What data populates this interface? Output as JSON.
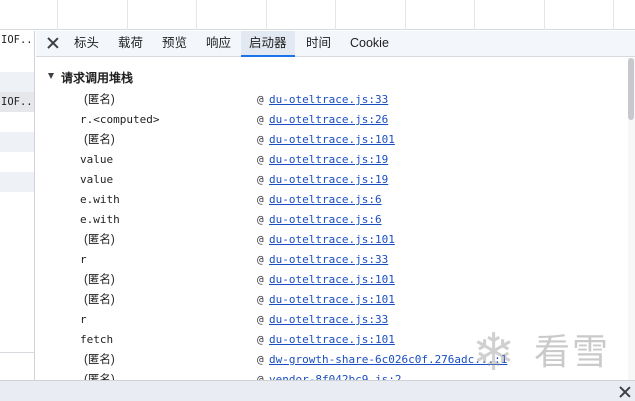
{
  "left_list": {
    "rows": [
      {
        "text": "IOF...",
        "style": "plain"
      },
      {
        "text": "",
        "style": "plain"
      },
      {
        "text": "",
        "style": "shade"
      },
      {
        "text": "IOF...",
        "style": "sel"
      },
      {
        "text": "",
        "style": "plain"
      },
      {
        "text": "",
        "style": "shade"
      },
      {
        "text": "",
        "style": "plain"
      },
      {
        "text": "",
        "style": "shade"
      }
    ]
  },
  "tabs": [
    {
      "label": "标头",
      "active": false
    },
    {
      "label": "载荷",
      "active": false
    },
    {
      "label": "预览",
      "active": false
    },
    {
      "label": "响应",
      "active": false
    },
    {
      "label": "启动器",
      "active": true
    },
    {
      "label": "时间",
      "active": false
    },
    {
      "label": "Cookie",
      "active": false
    }
  ],
  "section": {
    "title": "请求调用堆栈"
  },
  "at_symbol": "@",
  "frames": [
    {
      "fn": "(匿名)",
      "anon": true,
      "src": "du-oteltrace.js:33"
    },
    {
      "fn": "r.<computed>",
      "anon": false,
      "src": "du-oteltrace.js:26"
    },
    {
      "fn": "(匿名)",
      "anon": true,
      "src": "du-oteltrace.js:101"
    },
    {
      "fn": "value",
      "anon": false,
      "src": "du-oteltrace.js:19"
    },
    {
      "fn": "value",
      "anon": false,
      "src": "du-oteltrace.js:19"
    },
    {
      "fn": "e.with",
      "anon": false,
      "src": "du-oteltrace.js:6"
    },
    {
      "fn": "e.with",
      "anon": false,
      "src": "du-oteltrace.js:6"
    },
    {
      "fn": "(匿名)",
      "anon": true,
      "src": "du-oteltrace.js:101"
    },
    {
      "fn": "r",
      "anon": false,
      "src": "du-oteltrace.js:33"
    },
    {
      "fn": "(匿名)",
      "anon": true,
      "src": "du-oteltrace.js:101"
    },
    {
      "fn": "(匿名)",
      "anon": true,
      "src": "du-oteltrace.js:101"
    },
    {
      "fn": "r",
      "anon": false,
      "src": "du-oteltrace.js:33"
    },
    {
      "fn": "fetch",
      "anon": false,
      "src": "du-oteltrace.js:101"
    },
    {
      "fn": "(匿名)",
      "anon": true,
      "src": "dw-growth-share-6c026c0f.276adc...:1"
    },
    {
      "fn": "(匿名)",
      "anon": true,
      "src": "vendor-8f042bc9.js:2"
    }
  ],
  "watermark": {
    "glyph": "❄",
    "text": "看雪"
  },
  "colors": {
    "link": "#1a4ec2",
    "active_tab_underline": "#1a73e8",
    "tabbar_bg": "#f3f6fb"
  }
}
